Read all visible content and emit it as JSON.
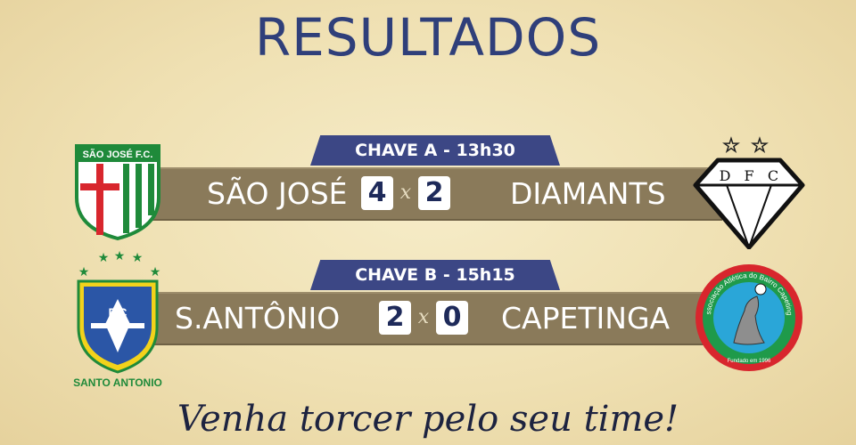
{
  "title": "RESULTADOS",
  "matches": [
    {
      "bracket": "CHAVE A - 13h30",
      "home": {
        "name": "SÃO JOSÉ",
        "score": "4",
        "badge_text": "SÃO JOSÉ F.C."
      },
      "away": {
        "name": "DIAMANTS",
        "score": "2",
        "badge_letters": [
          "D",
          "F",
          "C"
        ]
      },
      "separator": "x"
    },
    {
      "bracket": "CHAVE B - 15h15",
      "home": {
        "name": "S.ANTÔNIO",
        "score": "2",
        "badge_text": "F.C",
        "badge_caption": "SANTO ANTONIO"
      },
      "away": {
        "name": "CAPETINGA",
        "score": "0",
        "badge_text": "Associação Atlética do Bairro Capetinga",
        "badge_caption": "Fundado em 1996"
      },
      "separator": "x"
    }
  ],
  "tagline": "Venha torcer pelo seu time!",
  "colors": {
    "background": "#efe0b2",
    "title": "#2f3f7a",
    "chave_banner": "#3c4785",
    "score_bar": "#8a7a5a",
    "score_box": "#ffffff"
  }
}
